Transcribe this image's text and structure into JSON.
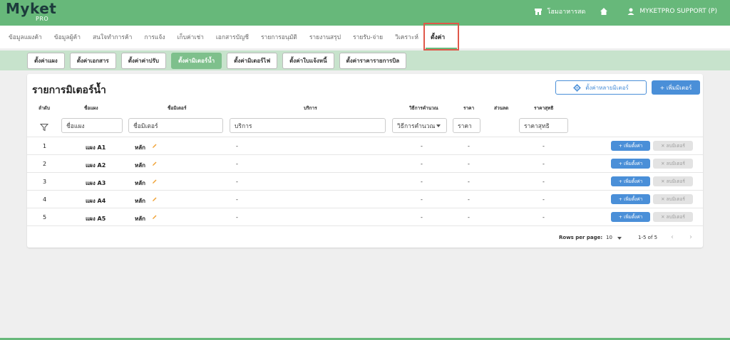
{
  "header": {
    "logo_text": "Myket",
    "logo_sub": "PRO",
    "store_name": "โฮมอาหารสด",
    "user_name": "MYKETPRO SUPPORT (P)"
  },
  "main_nav": [
    {
      "label": "ข้อมูลแผงค้า"
    },
    {
      "label": "ข้อมูลผู้ค้า"
    },
    {
      "label": "สนใจทำการค้า"
    },
    {
      "label": "การแจ้ง"
    },
    {
      "label": "เก็บค่าเช่า"
    },
    {
      "label": "เอกสารบัญชี"
    },
    {
      "label": "รายการอนุมัติ"
    },
    {
      "label": "รายงานสรุป"
    },
    {
      "label": "รายรับ-จ่าย"
    },
    {
      "label": "วิเคราะห์"
    },
    {
      "label": "ตั้งค่า",
      "active": true
    }
  ],
  "sub_nav": [
    {
      "label": "ตั้งค่าแผง"
    },
    {
      "label": "ตั้งค่าเอกสาร"
    },
    {
      "label": "ตั้งค่าค่าปรับ"
    },
    {
      "label": "ตั้งค่ามิเตอร์น้ำ",
      "active": true
    },
    {
      "label": "ตั้งค่ามิเตอร์ไฟ"
    },
    {
      "label": "ตั้งค่าใบแจ้งหนี้"
    },
    {
      "label": "ตั้งค่าราคารายการบิล"
    }
  ],
  "page": {
    "title": "รายการมิเตอร์น้ำ",
    "multi_button": "ตั้งค่าหลายมิเตอร์",
    "add_button": "+ เพิ่มมิเตอร์"
  },
  "table": {
    "headers": {
      "no": "ลำดับ",
      "panel": "ชื่อแผง",
      "meter": "ชื่อมิเตอร์",
      "service": "บริการ",
      "calc": "วิธีการคำนวณ",
      "price": "ราคา",
      "discount": "ส่วนลด",
      "net": "ราคาสุทธิ"
    },
    "filters": {
      "panel": "ชื่อแผง",
      "meter": "ชื่อมิเตอร์",
      "service": "บริการ",
      "calc": "วิธีการคำนวณ",
      "price": "ราคา",
      "net": "ราคาสุทธิ"
    },
    "rows": [
      {
        "no": "1",
        "panel": "แผง A1",
        "meter": "หลัก",
        "service": "-",
        "calc": "-",
        "price": "-",
        "net": "-",
        "add_label": "+ เพิ่มตั้งค่า",
        "del_label": "✕ ลบมิเตอร์"
      },
      {
        "no": "2",
        "panel": "แผง A2",
        "meter": "หลัก",
        "service": "-",
        "calc": "-",
        "price": "-",
        "net": "-",
        "add_label": "+ เพิ่มตั้งค่า",
        "del_label": "✕ ลบมิเตอร์"
      },
      {
        "no": "3",
        "panel": "แผง A3",
        "meter": "หลัก",
        "service": "-",
        "calc": "-",
        "price": "-",
        "net": "-",
        "add_label": "+ เพิ่มตั้งค่า",
        "del_label": "✕ ลบมิเตอร์"
      },
      {
        "no": "4",
        "panel": "แผง A4",
        "meter": "หลัก",
        "service": "-",
        "calc": "-",
        "price": "-",
        "net": "-",
        "add_label": "+ เพิ่มตั้งค่า",
        "del_label": "✕ ลบมิเตอร์"
      },
      {
        "no": "5",
        "panel": "แผง A5",
        "meter": "หลัก",
        "service": "-",
        "calc": "-",
        "price": "-",
        "net": "-",
        "add_label": "+ เพิ่มตั้งค่า",
        "del_label": "✕ ลบมิเตอร์"
      }
    ]
  },
  "pagination": {
    "rows_per_page_label": "Rows per page:",
    "rows_per_page": "10",
    "range": "1-5 of 5",
    "prev": "‹",
    "next": "›"
  },
  "colors": {
    "brand_green": "#67b87a",
    "subnav_bg": "#c7e3cc",
    "accent_blue": "#4a8fd8",
    "highlight_red": "#e0584a"
  }
}
